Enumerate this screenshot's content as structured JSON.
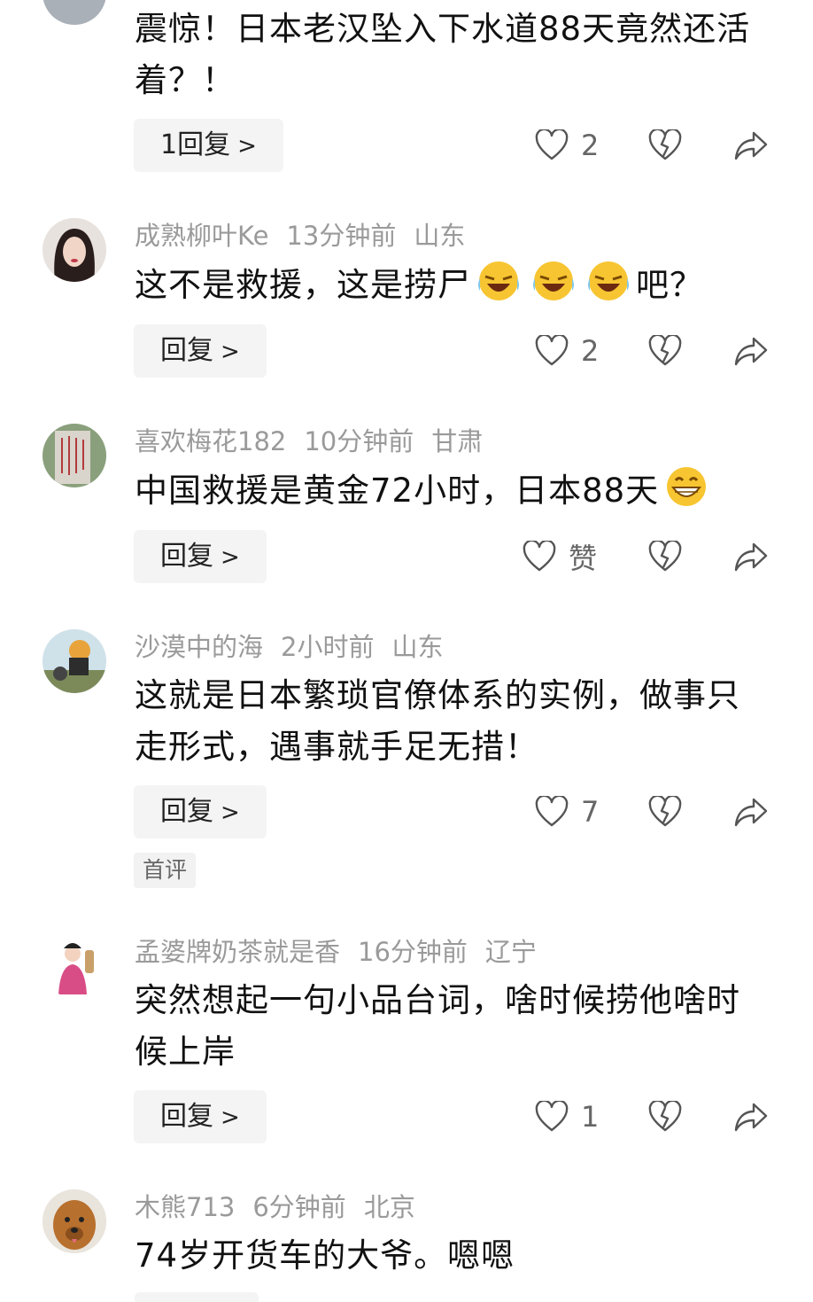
{
  "comments": [
    {
      "text": "震惊！日本老汉坠入下水道88天竟然还活着？！",
      "reply_label": "1回复",
      "like_count": "2"
    },
    {
      "username": "成熟柳叶Ke",
      "time": "13分钟前",
      "location": "山东",
      "text_before": "这不是救援，这是捞尸",
      "text_after": "吧？",
      "reply_label": "回复",
      "like_count": "2"
    },
    {
      "username": "喜欢梅花182",
      "time": "10分钟前",
      "location": "甘肃",
      "text": "中国救援是黄金72小时，日本88天",
      "reply_label": "回复",
      "like_count": "赞"
    },
    {
      "username": "沙漠中的海",
      "time": "2小时前",
      "location": "山东",
      "text": "这就是日本繁琐官僚体系的实例，做事只走形式，遇事就手足无措！",
      "reply_label": "回复",
      "like_count": "7",
      "badge": "首评"
    },
    {
      "username": "孟婆牌奶茶就是香",
      "time": "16分钟前",
      "location": "辽宁",
      "text": "突然想起一句小品台词，啥时候捞他啥时候上岸",
      "reply_label": "回复",
      "like_count": "1"
    },
    {
      "username": "木熊713",
      "time": "6分钟前",
      "location": "北京",
      "text": "74岁开货车的大爷。嗯嗯"
    }
  ],
  "icons": {
    "like": "heart-outline-icon",
    "dislike": "broken-heart-icon",
    "share": "share-arrow-icon",
    "emoji_laugh": "rolling-laughing-emoji",
    "emoji_grin": "grinning-emoji"
  },
  "colors": {
    "meta_text": "#9a9a9a",
    "body_text": "#111111",
    "reply_bg": "#f4f4f4",
    "icon_stroke": "#555555"
  }
}
